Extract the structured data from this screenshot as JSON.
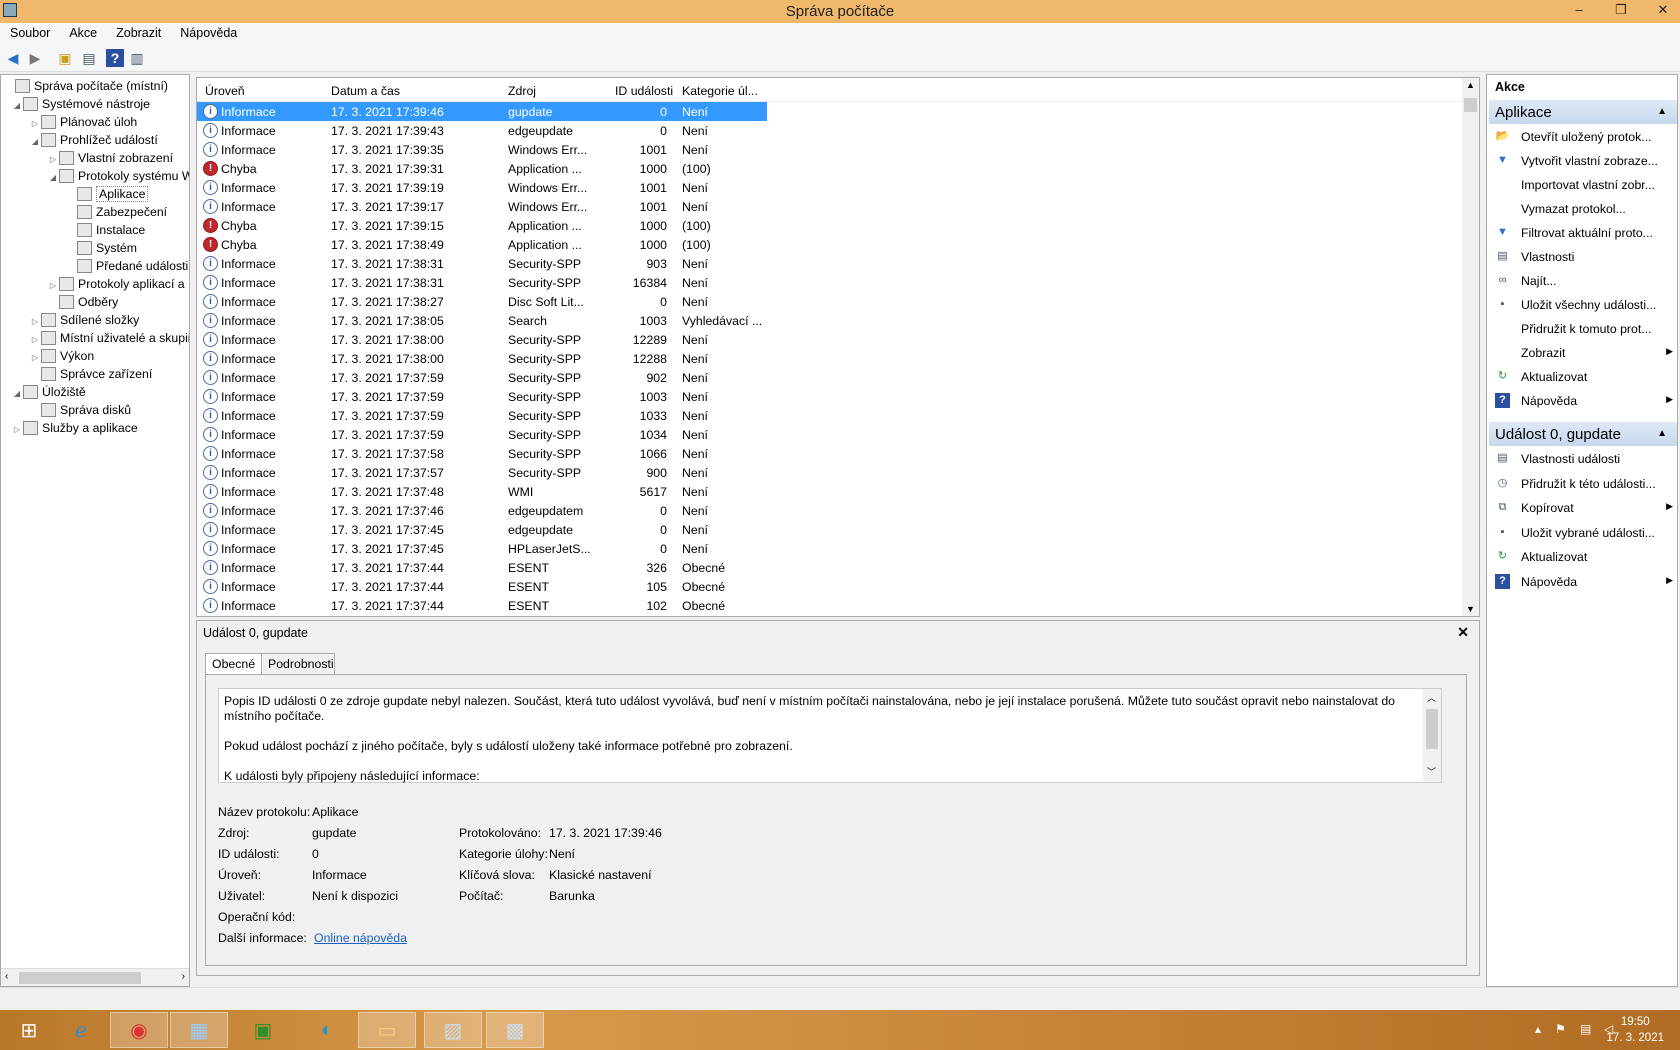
{
  "window": {
    "title": "Správa počítače"
  },
  "menu": [
    "Soubor",
    "Akce",
    "Zobrazit",
    "Nápověda"
  ],
  "tree": [
    {
      "label": "Správa počítače (místní)",
      "expander": "",
      "icon": "computer-management-icon"
    },
    {
      "label": "Systémové nástroje",
      "expander": "◢",
      "icon": "tools-icon"
    },
    {
      "label": "Plánovač úloh",
      "expander": "▷",
      "icon": "clock-icon"
    },
    {
      "label": "Prohlížeč událostí",
      "expander": "◢",
      "icon": "event-viewer-icon"
    },
    {
      "label": "Vlastní zobrazení",
      "expander": "▷",
      "icon": "folder-icon"
    },
    {
      "label": "Protokoly systému W",
      "expander": "◢",
      "icon": "folder-icon"
    },
    {
      "label": "Aplikace",
      "expander": "",
      "icon": "log-icon"
    },
    {
      "label": "Zabezpečení",
      "expander": "",
      "icon": "log-icon"
    },
    {
      "label": "Instalace",
      "expander": "",
      "icon": "log-icon"
    },
    {
      "label": "Systém",
      "expander": "",
      "icon": "log-icon"
    },
    {
      "label": "Předané události",
      "expander": "",
      "icon": "log-icon"
    },
    {
      "label": "Protokoly aplikací a",
      "expander": "▷",
      "icon": "folder-icon"
    },
    {
      "label": "Odběry",
      "expander": "",
      "icon": "subscriptions-icon"
    },
    {
      "label": "Sdílené složky",
      "expander": "▷",
      "icon": "shared-folder-icon"
    },
    {
      "label": "Místní uživatelé a skupin",
      "expander": "▷",
      "icon": "users-icon"
    },
    {
      "label": "Výkon",
      "expander": "▷",
      "icon": "performance-icon"
    },
    {
      "label": "Správce zařízení",
      "expander": "",
      "icon": "device-manager-icon"
    },
    {
      "label": "Úložiště",
      "expander": "◢",
      "icon": "storage-icon"
    },
    {
      "label": "Správa disků",
      "expander": "",
      "icon": "disk-icon"
    },
    {
      "label": "Služby a aplikace",
      "expander": "▷",
      "icon": "services-icon"
    }
  ],
  "events": {
    "columns": [
      "Úroveň",
      "Datum a čas",
      "Zdroj",
      "ID události",
      "Kategorie úl..."
    ],
    "rows": [
      {
        "level": "Informace",
        "type": "info",
        "date": "17. 3. 2021 17:39:46",
        "source": "gupdate",
        "id": "0",
        "category": "Není"
      },
      {
        "level": "Informace",
        "type": "info",
        "date": "17. 3. 2021 17:39:43",
        "source": "edgeupdate",
        "id": "0",
        "category": "Není"
      },
      {
        "level": "Informace",
        "type": "info",
        "date": "17. 3. 2021 17:39:35",
        "source": "Windows Err...",
        "id": "1001",
        "category": "Není"
      },
      {
        "level": "Chyba",
        "type": "error",
        "date": "17. 3. 2021 17:39:31",
        "source": "Application ...",
        "id": "1000",
        "category": "(100)"
      },
      {
        "level": "Informace",
        "type": "info",
        "date": "17. 3. 2021 17:39:19",
        "source": "Windows Err...",
        "id": "1001",
        "category": "Není"
      },
      {
        "level": "Informace",
        "type": "info",
        "date": "17. 3. 2021 17:39:17",
        "source": "Windows Err...",
        "id": "1001",
        "category": "Není"
      },
      {
        "level": "Chyba",
        "type": "error",
        "date": "17. 3. 2021 17:39:15",
        "source": "Application ...",
        "id": "1000",
        "category": "(100)"
      },
      {
        "level": "Chyba",
        "type": "error",
        "date": "17. 3. 2021 17:38:49",
        "source": "Application ...",
        "id": "1000",
        "category": "(100)"
      },
      {
        "level": "Informace",
        "type": "info",
        "date": "17. 3. 2021 17:38:31",
        "source": "Security-SPP",
        "id": "903",
        "category": "Není"
      },
      {
        "level": "Informace",
        "type": "info",
        "date": "17. 3. 2021 17:38:31",
        "source": "Security-SPP",
        "id": "16384",
        "category": "Není"
      },
      {
        "level": "Informace",
        "type": "info",
        "date": "17. 3. 2021 17:38:27",
        "source": "Disc Soft Lit...",
        "id": "0",
        "category": "Není"
      },
      {
        "level": "Informace",
        "type": "info",
        "date": "17. 3. 2021 17:38:05",
        "source": "Search",
        "id": "1003",
        "category": "Vyhledávací ..."
      },
      {
        "level": "Informace",
        "type": "info",
        "date": "17. 3. 2021 17:38:00",
        "source": "Security-SPP",
        "id": "12289",
        "category": "Není"
      },
      {
        "level": "Informace",
        "type": "info",
        "date": "17. 3. 2021 17:38:00",
        "source": "Security-SPP",
        "id": "12288",
        "category": "Není"
      },
      {
        "level": "Informace",
        "type": "info",
        "date": "17. 3. 2021 17:37:59",
        "source": "Security-SPP",
        "id": "902",
        "category": "Není"
      },
      {
        "level": "Informace",
        "type": "info",
        "date": "17. 3. 2021 17:37:59",
        "source": "Security-SPP",
        "id": "1003",
        "category": "Není"
      },
      {
        "level": "Informace",
        "type": "info",
        "date": "17. 3. 2021 17:37:59",
        "source": "Security-SPP",
        "id": "1033",
        "category": "Není"
      },
      {
        "level": "Informace",
        "type": "info",
        "date": "17. 3. 2021 17:37:59",
        "source": "Security-SPP",
        "id": "1034",
        "category": "Není"
      },
      {
        "level": "Informace",
        "type": "info",
        "date": "17. 3. 2021 17:37:58",
        "source": "Security-SPP",
        "id": "1066",
        "category": "Není"
      },
      {
        "level": "Informace",
        "type": "info",
        "date": "17. 3. 2021 17:37:57",
        "source": "Security-SPP",
        "id": "900",
        "category": "Není"
      },
      {
        "level": "Informace",
        "type": "info",
        "date": "17. 3. 2021 17:37:48",
        "source": "WMI",
        "id": "5617",
        "category": "Není"
      },
      {
        "level": "Informace",
        "type": "info",
        "date": "17. 3. 2021 17:37:46",
        "source": "edgeupdatem",
        "id": "0",
        "category": "Není"
      },
      {
        "level": "Informace",
        "type": "info",
        "date": "17. 3. 2021 17:37:45",
        "source": "edgeupdate",
        "id": "0",
        "category": "Není"
      },
      {
        "level": "Informace",
        "type": "info",
        "date": "17. 3. 2021 17:37:45",
        "source": "HPLaserJetS...",
        "id": "0",
        "category": "Není"
      },
      {
        "level": "Informace",
        "type": "info",
        "date": "17. 3. 2021 17:37:44",
        "source": "ESENT",
        "id": "326",
        "category": "Obecné"
      },
      {
        "level": "Informace",
        "type": "info",
        "date": "17. 3. 2021 17:37:44",
        "source": "ESENT",
        "id": "105",
        "category": "Obecné"
      },
      {
        "level": "Informace",
        "type": "info",
        "date": "17. 3. 2021 17:37:44",
        "source": "ESENT",
        "id": "102",
        "category": "Obecné"
      }
    ]
  },
  "detail": {
    "header": "Událost 0, gupdate",
    "tabs": [
      "Obecné",
      "Podrobnosti"
    ],
    "desc1": "Popis ID události 0 ze zdroje gupdate nebyl nalezen. Součást, která tuto událost vyvolává, buď není v místním počítači nainstalována, nebo je její instalace porušená. Můžete tuto součást opravit nebo nainstalovat do místního počítače.",
    "desc2": "Pokud událost pochází z jiného počítače, byly s událostí uloženy také informace potřebné pro zobrazení.",
    "desc3": "K události byly připojeny následující informace:",
    "log_name_label": "Název protokolu:",
    "log_name": "Aplikace",
    "source_label": "Zdroj:",
    "source": "gupdate",
    "logged_label": "Protokolováno:",
    "logged": "17. 3. 2021 17:39:46",
    "event_id_label": "ID události:",
    "event_id": "0",
    "task_label": "Kategorie úlohy:",
    "task": "Není",
    "level_label": "Úroveň:",
    "level": "Informace",
    "keywords_label": "Klíčová slova:",
    "keywords": "Klasické nastavení",
    "user_label": "Uživatel:",
    "user": "Není k dispozici",
    "computer_label": "Počítač:",
    "computer": "Barunka",
    "opcode_label": "Operační kód:",
    "more_label": "Další informace:",
    "more_link": "Online nápověda"
  },
  "actions": {
    "title": "Akce",
    "section1": "Aplikace",
    "items1": [
      {
        "label": "Otevřít uložený protok...",
        "icon": "open-folder-icon",
        "arrow": ""
      },
      {
        "label": "Vytvořit vlastní zobraze...",
        "icon": "filter-icon",
        "arrow": ""
      },
      {
        "label": "Importovat vlastní zobr...",
        "icon": "",
        "arrow": ""
      },
      {
        "label": "Vymazat protokol...",
        "icon": "",
        "arrow": ""
      },
      {
        "label": "Filtrovat aktuální proto...",
        "icon": "filter-icon",
        "arrow": ""
      },
      {
        "label": "Vlastnosti",
        "icon": "properties-icon",
        "arrow": ""
      },
      {
        "label": "Najít...",
        "icon": "binoculars-icon",
        "arrow": ""
      },
      {
        "label": "Uložit všechny události...",
        "icon": "save-icon",
        "arrow": ""
      },
      {
        "label": "Přidružit k tomuto prot...",
        "icon": "",
        "arrow": ""
      },
      {
        "label": "Zobrazit",
        "icon": "",
        "arrow": "▶"
      },
      {
        "label": "Aktualizovat",
        "icon": "refresh-icon",
        "arrow": ""
      },
      {
        "label": "Nápověda",
        "icon": "help-icon",
        "arrow": "▶"
      }
    ],
    "section2": "Událost 0, gupdate",
    "items2": [
      {
        "label": "Vlastnosti události",
        "icon": "properties-icon",
        "arrow": ""
      },
      {
        "label": "Přidružit k této události...",
        "icon": "task-icon",
        "arrow": ""
      },
      {
        "label": "Kopírovat",
        "icon": "copy-icon",
        "arrow": "▶"
      },
      {
        "label": "Uložit vybrané události...",
        "icon": "save-icon",
        "arrow": ""
      },
      {
        "label": "Aktualizovat",
        "icon": "refresh-icon",
        "arrow": ""
      },
      {
        "label": "Nápověda",
        "icon": "help-icon",
        "arrow": "▶"
      }
    ]
  },
  "taskbar": {
    "time": "19:50",
    "date": "17. 3. 2021"
  }
}
